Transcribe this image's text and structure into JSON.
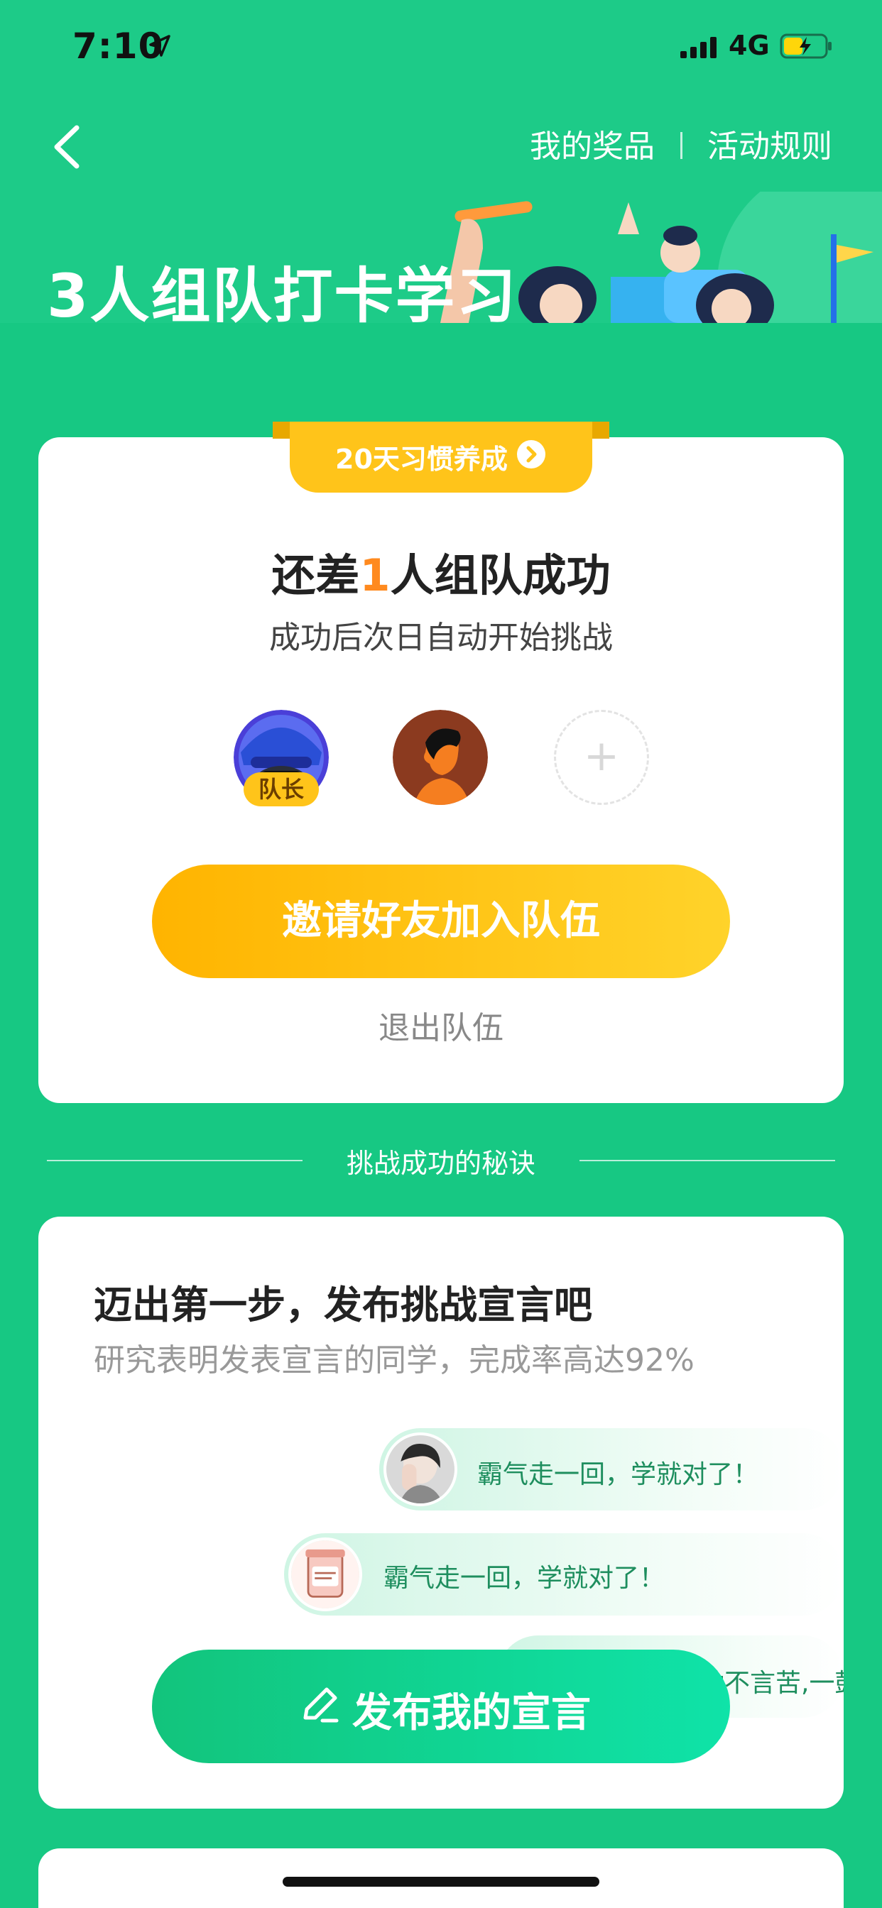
{
  "status_bar": {
    "time": "7:10",
    "network": "4G"
  },
  "header": {
    "my_prizes": "我的奖品",
    "rules": "活动规则",
    "banner_title": "3人组队打卡学习"
  },
  "team_card": {
    "ribbon_label": "20天习惯养成",
    "title_prefix": "还差",
    "title_number": "1",
    "title_suffix": "人组队成功",
    "subtitle": "成功后次日自动开始挑战",
    "leader_badge": "队长",
    "add_member_symbol": "+",
    "invite_button": "邀请好友加入队伍",
    "quit_link": "退出队伍"
  },
  "section_title": "挑战成功的秘诀",
  "declaration": {
    "title": "迈出第一步，发布挑战宣言吧",
    "subtitle": "研究表明发表宣言的同学，完成率高达92%",
    "bubbles": [
      {
        "text": "霸气走一回，学就对了！"
      },
      {
        "text": "霸气走一回，学就对了！"
      },
      {
        "text": "动不言苦,一鼓"
      }
    ],
    "publish_button": "发布我的宣言"
  },
  "colors": {
    "background": "#17C883",
    "accent_yellow": "#FFC41A",
    "accent_orange": "#FF8A1F",
    "bubble_text": "#1E8E5E"
  }
}
